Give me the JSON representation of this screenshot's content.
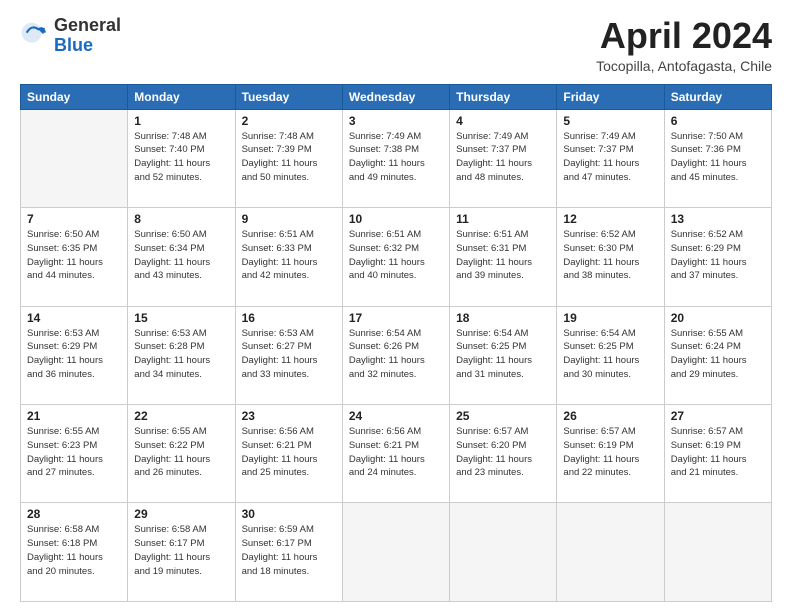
{
  "header": {
    "logo_general": "General",
    "logo_blue": "Blue",
    "month_title": "April 2024",
    "location": "Tocopilla, Antofagasta, Chile"
  },
  "weekdays": [
    "Sunday",
    "Monday",
    "Tuesday",
    "Wednesday",
    "Thursday",
    "Friday",
    "Saturday"
  ],
  "weeks": [
    [
      {
        "day": "",
        "sunrise": "",
        "sunset": "",
        "daylight": "",
        "empty": true
      },
      {
        "day": "1",
        "sunrise": "7:48 AM",
        "sunset": "7:40 PM",
        "daylight": "11 hours and 52 minutes."
      },
      {
        "day": "2",
        "sunrise": "7:48 AM",
        "sunset": "7:39 PM",
        "daylight": "11 hours and 50 minutes."
      },
      {
        "day": "3",
        "sunrise": "7:49 AM",
        "sunset": "7:38 PM",
        "daylight": "11 hours and 49 minutes."
      },
      {
        "day": "4",
        "sunrise": "7:49 AM",
        "sunset": "7:37 PM",
        "daylight": "11 hours and 48 minutes."
      },
      {
        "day": "5",
        "sunrise": "7:49 AM",
        "sunset": "7:37 PM",
        "daylight": "11 hours and 47 minutes."
      },
      {
        "day": "6",
        "sunrise": "7:50 AM",
        "sunset": "7:36 PM",
        "daylight": "11 hours and 45 minutes."
      }
    ],
    [
      {
        "day": "7",
        "sunrise": "6:50 AM",
        "sunset": "6:35 PM",
        "daylight": "11 hours and 44 minutes."
      },
      {
        "day": "8",
        "sunrise": "6:50 AM",
        "sunset": "6:34 PM",
        "daylight": "11 hours and 43 minutes."
      },
      {
        "day": "9",
        "sunrise": "6:51 AM",
        "sunset": "6:33 PM",
        "daylight": "11 hours and 42 minutes."
      },
      {
        "day": "10",
        "sunrise": "6:51 AM",
        "sunset": "6:32 PM",
        "daylight": "11 hours and 40 minutes."
      },
      {
        "day": "11",
        "sunrise": "6:51 AM",
        "sunset": "6:31 PM",
        "daylight": "11 hours and 39 minutes."
      },
      {
        "day": "12",
        "sunrise": "6:52 AM",
        "sunset": "6:30 PM",
        "daylight": "11 hours and 38 minutes."
      },
      {
        "day": "13",
        "sunrise": "6:52 AM",
        "sunset": "6:29 PM",
        "daylight": "11 hours and 37 minutes."
      }
    ],
    [
      {
        "day": "14",
        "sunrise": "6:53 AM",
        "sunset": "6:29 PM",
        "daylight": "11 hours and 36 minutes."
      },
      {
        "day": "15",
        "sunrise": "6:53 AM",
        "sunset": "6:28 PM",
        "daylight": "11 hours and 34 minutes."
      },
      {
        "day": "16",
        "sunrise": "6:53 AM",
        "sunset": "6:27 PM",
        "daylight": "11 hours and 33 minutes."
      },
      {
        "day": "17",
        "sunrise": "6:54 AM",
        "sunset": "6:26 PM",
        "daylight": "11 hours and 32 minutes."
      },
      {
        "day": "18",
        "sunrise": "6:54 AM",
        "sunset": "6:25 PM",
        "daylight": "11 hours and 31 minutes."
      },
      {
        "day": "19",
        "sunrise": "6:54 AM",
        "sunset": "6:25 PM",
        "daylight": "11 hours and 30 minutes."
      },
      {
        "day": "20",
        "sunrise": "6:55 AM",
        "sunset": "6:24 PM",
        "daylight": "11 hours and 29 minutes."
      }
    ],
    [
      {
        "day": "21",
        "sunrise": "6:55 AM",
        "sunset": "6:23 PM",
        "daylight": "11 hours and 27 minutes."
      },
      {
        "day": "22",
        "sunrise": "6:55 AM",
        "sunset": "6:22 PM",
        "daylight": "11 hours and 26 minutes."
      },
      {
        "day": "23",
        "sunrise": "6:56 AM",
        "sunset": "6:21 PM",
        "daylight": "11 hours and 25 minutes."
      },
      {
        "day": "24",
        "sunrise": "6:56 AM",
        "sunset": "6:21 PM",
        "daylight": "11 hours and 24 minutes."
      },
      {
        "day": "25",
        "sunrise": "6:57 AM",
        "sunset": "6:20 PM",
        "daylight": "11 hours and 23 minutes."
      },
      {
        "day": "26",
        "sunrise": "6:57 AM",
        "sunset": "6:19 PM",
        "daylight": "11 hours and 22 minutes."
      },
      {
        "day": "27",
        "sunrise": "6:57 AM",
        "sunset": "6:19 PM",
        "daylight": "11 hours and 21 minutes."
      }
    ],
    [
      {
        "day": "28",
        "sunrise": "6:58 AM",
        "sunset": "6:18 PM",
        "daylight": "11 hours and 20 minutes."
      },
      {
        "day": "29",
        "sunrise": "6:58 AM",
        "sunset": "6:17 PM",
        "daylight": "11 hours and 19 minutes."
      },
      {
        "day": "30",
        "sunrise": "6:59 AM",
        "sunset": "6:17 PM",
        "daylight": "11 hours and 18 minutes."
      },
      {
        "day": "",
        "sunrise": "",
        "sunset": "",
        "daylight": "",
        "empty": true
      },
      {
        "day": "",
        "sunrise": "",
        "sunset": "",
        "daylight": "",
        "empty": true
      },
      {
        "day": "",
        "sunrise": "",
        "sunset": "",
        "daylight": "",
        "empty": true
      },
      {
        "day": "",
        "sunrise": "",
        "sunset": "",
        "daylight": "",
        "empty": true
      }
    ]
  ],
  "labels": {
    "sunrise": "Sunrise:",
    "sunset": "Sunset:",
    "daylight": "Daylight:"
  }
}
